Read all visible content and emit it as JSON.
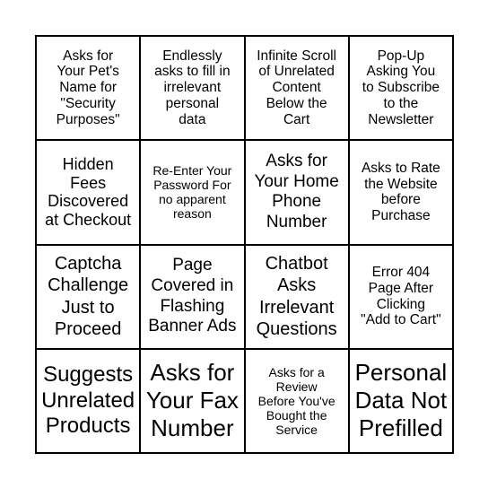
{
  "cells": [
    "Asks for\nYour Pet's\nName for\n\"Security\nPurposes\"",
    "Endlessly\nasks to fill in\nirrelevant\npersonal\ndata",
    "Infinite Scroll\nof Unrelated\nContent\nBelow the\nCart",
    "Pop-Up\nAsking You\nto Subscribe\nto the\nNewsletter",
    "Hidden\nFees\nDiscovered\nat Checkout",
    "Re-Enter Your\nPassword For\nno apparent\nreason",
    "Asks for\nYour Home\nPhone\nNumber",
    "Asks to Rate\nthe Website\nbefore\nPurchase",
    "Captcha\nChallenge\nJust to\nProceed",
    "Page\nCovered in\nFlashing\nBanner Ads",
    "Chatbot\nAsks\nIrrelevant\nQuestions",
    "Error 404\nPage After\nClicking\n\"Add to Cart\"",
    "Suggests\nUnrelated\nProducts",
    "Asks for\nYour Fax\nNumber",
    "Asks for a\nReview\nBefore You've\nBought the\nService",
    "Personal\nData Not\nPrefilled"
  ]
}
